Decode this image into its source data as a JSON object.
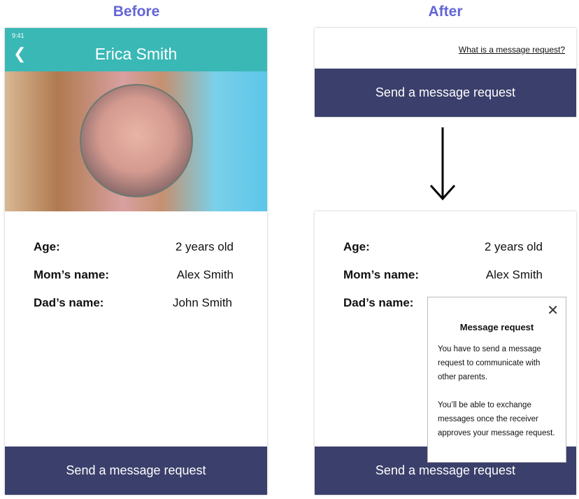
{
  "headings": {
    "before": "Before",
    "after": "After"
  },
  "before": {
    "status_time": "9:41",
    "title": "Erica Smith",
    "rows": [
      {
        "label": "Age:",
        "value": "2 years old"
      },
      {
        "label": "Mom’s name:",
        "value": "Alex Smith"
      },
      {
        "label": "Dad’s name:",
        "value": "John Smith"
      }
    ],
    "button": "Send a message request"
  },
  "after_top": {
    "link": "What is a message request?",
    "button": "Send a message request"
  },
  "after": {
    "rows": [
      {
        "label": "Age:",
        "value": "2 years old"
      },
      {
        "label": "Mom’s name:",
        "value": "Alex Smith"
      },
      {
        "label": "Dad’s name:",
        "value": ""
      }
    ],
    "button": "Send a message request",
    "popup": {
      "title": "Message request",
      "p1": "You have to send a message request to communicate with other parents.",
      "p2": "You’ll be able to exchange messages once the receiver approves your message request."
    }
  },
  "colors": {
    "teal": "#3ab8b6",
    "navy": "#3b3f6b",
    "heading": "#6366d6"
  }
}
